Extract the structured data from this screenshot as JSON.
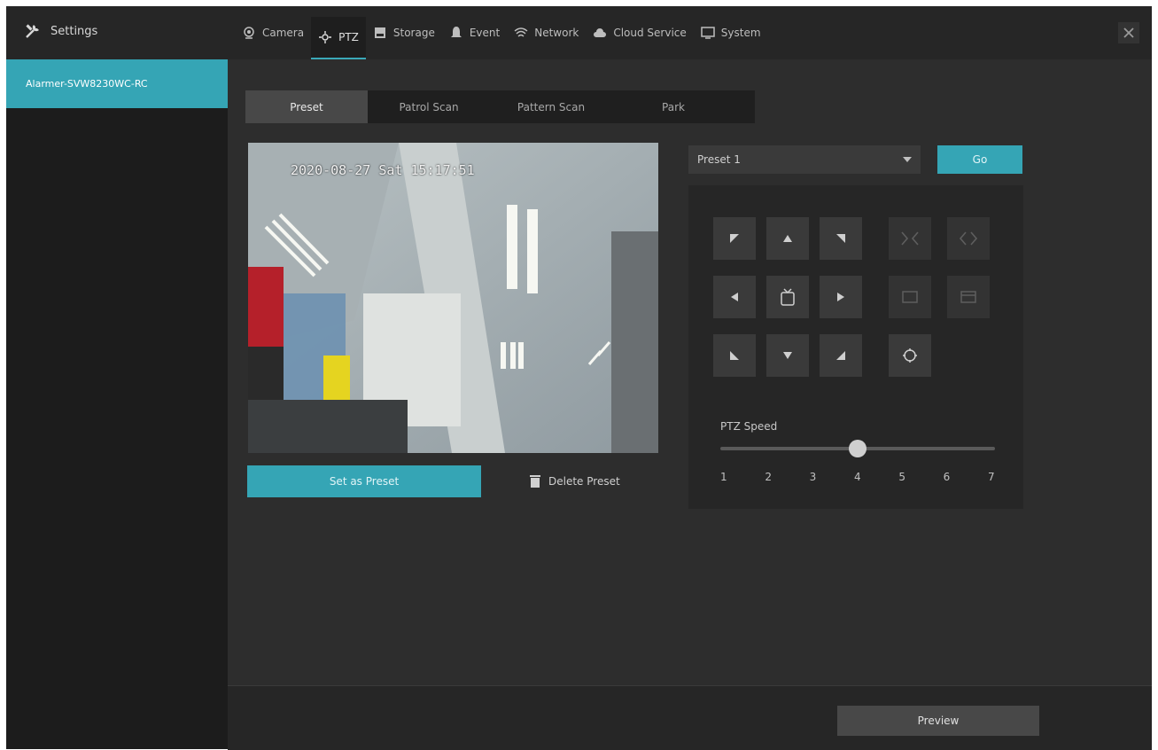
{
  "app": {
    "title": "Settings",
    "close_icon": "close-icon"
  },
  "nav_tabs": [
    {
      "label": "Camera",
      "icon": "camera-icon",
      "active": false
    },
    {
      "label": "PTZ",
      "icon": "ptz-icon",
      "active": true
    },
    {
      "label": "Storage",
      "icon": "storage-icon",
      "active": false
    },
    {
      "label": "Event",
      "icon": "event-icon",
      "active": false
    },
    {
      "label": "Network",
      "icon": "network-icon",
      "active": false
    },
    {
      "label": "Cloud Service",
      "icon": "cloud-icon",
      "active": false
    },
    {
      "label": "System",
      "icon": "system-icon",
      "active": false
    }
  ],
  "sidebar": {
    "items": [
      {
        "label": "Alarmer-SVW8230WC-RC"
      }
    ]
  },
  "subtabs": [
    {
      "label": "Preset",
      "active": true
    },
    {
      "label": "Patrol Scan",
      "active": false
    },
    {
      "label": "Pattern Scan",
      "active": false
    },
    {
      "label": "Park",
      "active": false
    }
  ],
  "video": {
    "timestamp": "2020-08-27 Sat 15:17:51"
  },
  "actions": {
    "add_preset": "Set as Preset",
    "delete_preset": "Delete Preset"
  },
  "preset": {
    "selected": "Preset 1",
    "go_button": "Go"
  },
  "ptz_controls": {
    "speed_label": "PTZ Speed",
    "speed_value": 4,
    "speed_min": 1,
    "speed_max": 7,
    "ticks": [
      "1",
      "2",
      "3",
      "4",
      "5",
      "6",
      "7"
    ],
    "buttons": [
      {
        "name": "up-left-button",
        "icon": "arrow-up-left-icon"
      },
      {
        "name": "up-button",
        "icon": "arrow-up-icon"
      },
      {
        "name": "up-right-button",
        "icon": "arrow-up-right-icon"
      },
      {
        "name": "zoom-in-button",
        "icon": "zoom-in-icon"
      },
      {
        "name": "zoom-out-button",
        "icon": "zoom-out-icon"
      },
      {
        "name": "left-button",
        "icon": "arrow-left-icon"
      },
      {
        "name": "home-button",
        "icon": "home-icon"
      },
      {
        "name": "right-button",
        "icon": "arrow-right-icon"
      },
      {
        "name": "focus-near-button",
        "icon": "focus-near-icon"
      },
      {
        "name": "focus-far-button",
        "icon": "focus-far-icon"
      },
      {
        "name": "down-left-button",
        "icon": "arrow-down-left-icon"
      },
      {
        "name": "down-button",
        "icon": "arrow-down-icon"
      },
      {
        "name": "down-right-button",
        "icon": "arrow-down-right-icon"
      },
      {
        "name": "auto-focus-button",
        "icon": "auto-focus-icon"
      }
    ]
  },
  "footer": {
    "preview_button": "Preview"
  }
}
